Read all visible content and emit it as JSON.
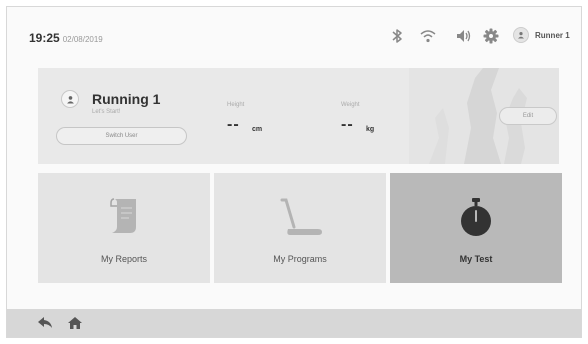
{
  "status_bar": {
    "time": "19:25",
    "date": "02/08/2019",
    "user_name": "Runner 1",
    "icons": [
      "bluetooth-icon",
      "wifi-icon",
      "volume-icon",
      "settings-icon",
      "avatar-icon"
    ]
  },
  "profile": {
    "name": "Running 1",
    "tagline": "Let's Start!",
    "switch_user_label": "Switch User",
    "height_label": "Height",
    "height_value": "--",
    "height_unit": "cm",
    "weight_label": "Weight",
    "weight_value": "--",
    "weight_unit": "kg",
    "edit_label": "Edit"
  },
  "tiles": [
    {
      "label": "My Reports",
      "icon": "report-icon",
      "selected": false
    },
    {
      "label": "My Programs",
      "icon": "treadmill-icon",
      "selected": false
    },
    {
      "label": "My Test",
      "icon": "stopwatch-icon",
      "selected": true
    }
  ],
  "bottom_bar": {
    "icons": [
      "back-icon",
      "home-icon"
    ]
  },
  "colors": {
    "tile_bg": "#e4e4e4",
    "tile_selected_bg": "#b9b9b9",
    "bottom_bar_bg": "#d7d7d7"
  }
}
